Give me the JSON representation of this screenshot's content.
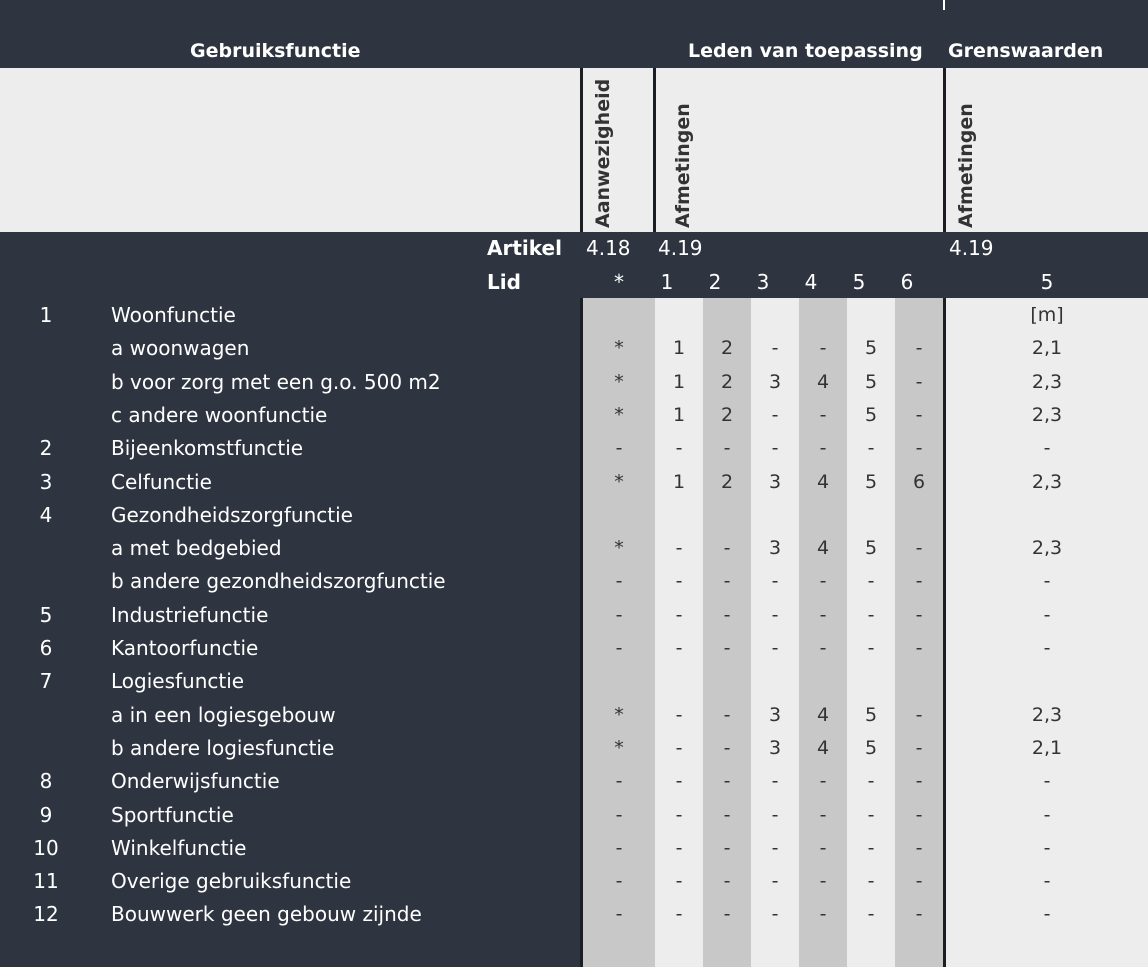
{
  "header": {
    "gebruiksfunctie": "Gebruiksfunctie",
    "leden": "Leden van toepassing",
    "grenswaarden": "Grenswaarden"
  },
  "vertical_labels": {
    "aanwezigheid": "Aanwezigheid",
    "afmetingen1": "Afmetingen",
    "afmetingen2": "Afmetingen"
  },
  "artikel": {
    "label": "Artikel",
    "c1": "4.18",
    "c2": "4.19",
    "c3": "4.19"
  },
  "lid": {
    "label": "Lid",
    "c0": "*",
    "c1": "1",
    "c2": "2",
    "c3": "3",
    "c4": "4",
    "c5": "5",
    "c6": "6",
    "g": "5"
  },
  "rows": [
    {
      "num": "1",
      "label": "Woonfunctie",
      "c": [
        "",
        "",
        "",
        "",
        "",
        "",
        ""
      ],
      "g": "[m]"
    },
    {
      "num": "",
      "label": "a  woonwagen",
      "c": [
        "*",
        "1",
        "2",
        "-",
        "-",
        "5",
        "-"
      ],
      "g": "2,1"
    },
    {
      "num": "",
      "label": "b  voor zorg met een g.o. 500 m2",
      "c": [
        "*",
        "1",
        "2",
        "3",
        "4",
        "5",
        "-"
      ],
      "g": "2,3"
    },
    {
      "num": "",
      "label": "c  andere woonfunctie",
      "c": [
        "*",
        "1",
        "2",
        "-",
        "-",
        "5",
        "-"
      ],
      "g": "2,3"
    },
    {
      "num": "2",
      "label": "Bijeenkomstfunctie",
      "c": [
        "-",
        "-",
        "-",
        "-",
        "-",
        "-",
        "-"
      ],
      "g": "-"
    },
    {
      "num": "3",
      "label": "Celfunctie",
      "c": [
        "*",
        "1",
        "2",
        "3",
        "4",
        "5",
        "6"
      ],
      "g": "2,3"
    },
    {
      "num": "4",
      "label": "Gezondheidszorgfunctie",
      "c": [
        "",
        "",
        "",
        "",
        "",
        "",
        ""
      ],
      "g": ""
    },
    {
      "num": "",
      "label": "a  met bedgebied",
      "c": [
        "*",
        "-",
        "-",
        "3",
        "4",
        "5",
        "-"
      ],
      "g": "2,3"
    },
    {
      "num": "",
      "label": "b  andere gezondheidszorgfunctie",
      "c": [
        "-",
        "-",
        "-",
        "-",
        "-",
        "-",
        "-"
      ],
      "g": "-"
    },
    {
      "num": "5",
      "label": "Industriefunctie",
      "c": [
        "-",
        "-",
        "-",
        "-",
        "-",
        "-",
        "-"
      ],
      "g": "-"
    },
    {
      "num": "6",
      "label": "Kantoorfunctie",
      "c": [
        "-",
        "-",
        "-",
        "-",
        "-",
        "-",
        "-"
      ],
      "g": "-"
    },
    {
      "num": "7",
      "label": "Logiesfunctie",
      "c": [
        "",
        "",
        "",
        "",
        "",
        "",
        ""
      ],
      "g": ""
    },
    {
      "num": "",
      "label": "a  in een logiesgebouw",
      "c": [
        "*",
        "-",
        "-",
        "3",
        "4",
        "5",
        "-"
      ],
      "g": "2,3"
    },
    {
      "num": "",
      "label": "b  andere logiesfunctie",
      "c": [
        "*",
        "-",
        "-",
        "3",
        "4",
        "5",
        "-"
      ],
      "g": "2,1"
    },
    {
      "num": "8",
      "label": "Onderwijsfunctie",
      "c": [
        "-",
        "-",
        "-",
        "-",
        "-",
        "-",
        "-"
      ],
      "g": "-"
    },
    {
      "num": "9",
      "label": "Sportfunctie",
      "c": [
        "-",
        "-",
        "-",
        "-",
        "-",
        "-",
        "-"
      ],
      "g": "-"
    },
    {
      "num": "10",
      "label": "Winkelfunctie",
      "c": [
        "-",
        "-",
        "-",
        "-",
        "-",
        "-",
        "-"
      ],
      "g": "-"
    },
    {
      "num": "11",
      "label": "Overige gebruiksfunctie",
      "c": [
        "-",
        "-",
        "-",
        "-",
        "-",
        "-",
        "-"
      ],
      "g": "-"
    },
    {
      "num": "12",
      "label": "Bouwwerk geen gebouw zijnde",
      "c": [
        "-",
        "-",
        "-",
        "-",
        "-",
        "-",
        "-"
      ],
      "g": "-"
    }
  ]
}
